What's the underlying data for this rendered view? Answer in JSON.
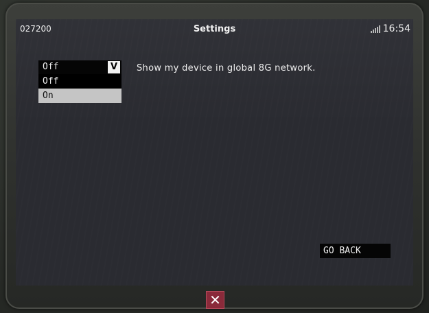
{
  "status_bar": {
    "id_text": "027200",
    "title": "Settings",
    "time": "16:54",
    "signal_icon": "signal-icon"
  },
  "setting": {
    "label": "Show my device in global 8G network.",
    "dropdown": {
      "selected": "Off",
      "toggle_label": "V",
      "options": [
        "Off",
        "On"
      ],
      "highlighted": "On"
    }
  },
  "footer": {
    "go_back_label": "GO BACK",
    "close_icon": "close-icon",
    "close_glyph": "✕"
  },
  "colors": {
    "screen_bg": "#2a2b31",
    "close_accent": "#8a2a3a",
    "highlight": "#c5c5c5"
  }
}
